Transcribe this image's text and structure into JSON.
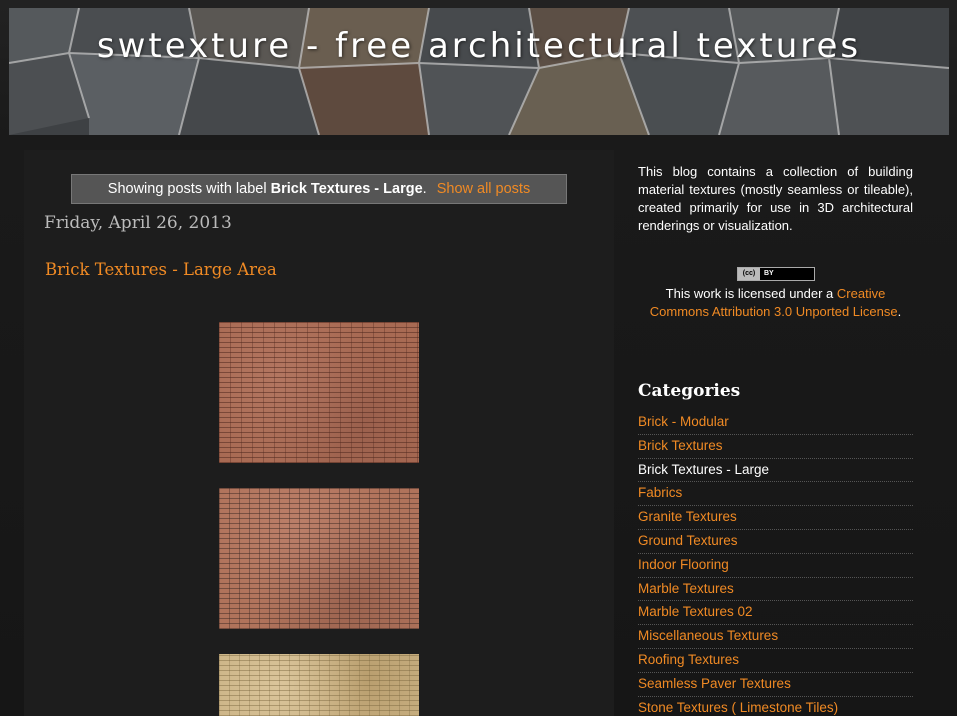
{
  "header": {
    "title": "swtexture - free architectural textures"
  },
  "status_bar": {
    "prefix": "Showing posts with label ",
    "label": "Brick Textures - Large",
    "suffix": ".",
    "show_all": "Show all posts"
  },
  "post": {
    "date": "Friday, April 26, 2013",
    "title": "Brick Textures - Large Area"
  },
  "sidebar": {
    "about": "This blog contains a collection of building material textures (mostly seamless or tileable), created primarily for use in 3D architectural renderings or visualization.",
    "cc_badge": {
      "cc": "(cc)",
      "by": "BY"
    },
    "license_prefix": "This work is licensed under a ",
    "license_link": "Creative Commons Attribution 3.0 Unported License",
    "license_suffix": ".",
    "categories_heading": "Categories",
    "categories": [
      {
        "label": "Brick - Modular",
        "current": false
      },
      {
        "label": "Brick Textures",
        "current": false
      },
      {
        "label": "Brick Textures - Large",
        "current": true
      },
      {
        "label": "Fabrics",
        "current": false
      },
      {
        "label": "Granite Textures",
        "current": false
      },
      {
        "label": "Ground Textures",
        "current": false
      },
      {
        "label": "Indoor Flooring",
        "current": false
      },
      {
        "label": "Marble Textures",
        "current": false
      },
      {
        "label": "Marble Textures 02",
        "current": false
      },
      {
        "label": "Miscellaneous Textures",
        "current": false
      },
      {
        "label": "Roofing Textures",
        "current": false
      },
      {
        "label": "Seamless Paver Textures",
        "current": false
      },
      {
        "label": "Stone Textures ( Limestone Tiles)",
        "current": false
      }
    ]
  },
  "colors": {
    "link": "#f08a24",
    "background": "#1b1b1b",
    "text": "#ffffff"
  }
}
